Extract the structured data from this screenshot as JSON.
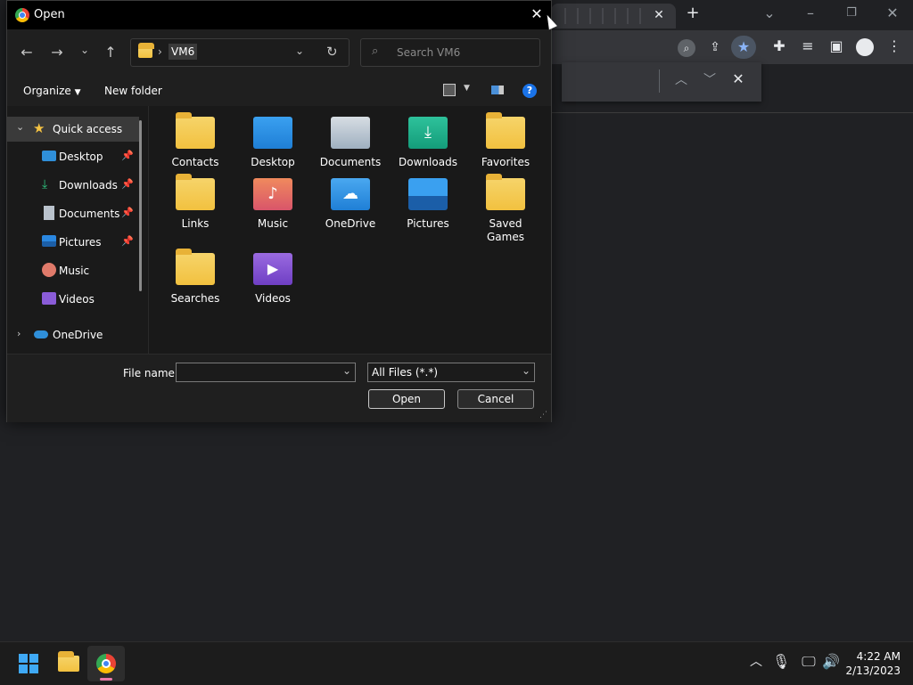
{
  "dialog": {
    "title": "Open",
    "address": {
      "folder": "VM6",
      "separator": "›"
    },
    "search_placeholder": "Search VM6",
    "toolbar": {
      "organize": "Organize",
      "new_folder": "New folder",
      "help": "?"
    },
    "nav_pane": [
      {
        "label": "Quick access",
        "icon": "star-icon",
        "expanded": true
      },
      {
        "label": "Desktop",
        "icon": "desktop-folder-icon",
        "pinned": true
      },
      {
        "label": "Downloads",
        "icon": "download-icon",
        "pinned": true
      },
      {
        "label": "Documents",
        "icon": "document-icon",
        "pinned": true
      },
      {
        "label": "Pictures",
        "icon": "pictures-icon",
        "pinned": true
      },
      {
        "label": "Music",
        "icon": "music-icon",
        "pinned": false
      },
      {
        "label": "Videos",
        "icon": "videos-icon",
        "pinned": false
      },
      {
        "label": "OneDrive",
        "icon": "onedrive-icon",
        "expanded": false
      }
    ],
    "files": [
      {
        "label": "Contacts",
        "icon": "folder-icon"
      },
      {
        "label": "Desktop",
        "icon": "desktop-folder-icon"
      },
      {
        "label": "Documents",
        "icon": "documents-folder-icon"
      },
      {
        "label": "Downloads",
        "icon": "downloads-folder-icon"
      },
      {
        "label": "Favorites",
        "icon": "folder-icon"
      },
      {
        "label": "Links",
        "icon": "folder-icon"
      },
      {
        "label": "Music",
        "icon": "music-folder-icon"
      },
      {
        "label": "OneDrive",
        "icon": "onedrive-folder-icon"
      },
      {
        "label": "Pictures",
        "icon": "pictures-folder-icon"
      },
      {
        "label": "Saved Games",
        "icon": "folder-icon"
      },
      {
        "label": "Searches",
        "icon": "folder-icon"
      },
      {
        "label": "Videos",
        "icon": "videos-folder-icon"
      }
    ],
    "file_name_label": "File name:",
    "file_name_value": "",
    "file_type": "All Files (*.*)",
    "open_button": "Open",
    "cancel_button": "Cancel"
  },
  "taskbar": {
    "time": "4:22 AM",
    "date": "2/13/2023"
  },
  "colors": {
    "accent": "#0078d4",
    "folder": "#f2c13f",
    "dialog_bg": "#191919"
  }
}
